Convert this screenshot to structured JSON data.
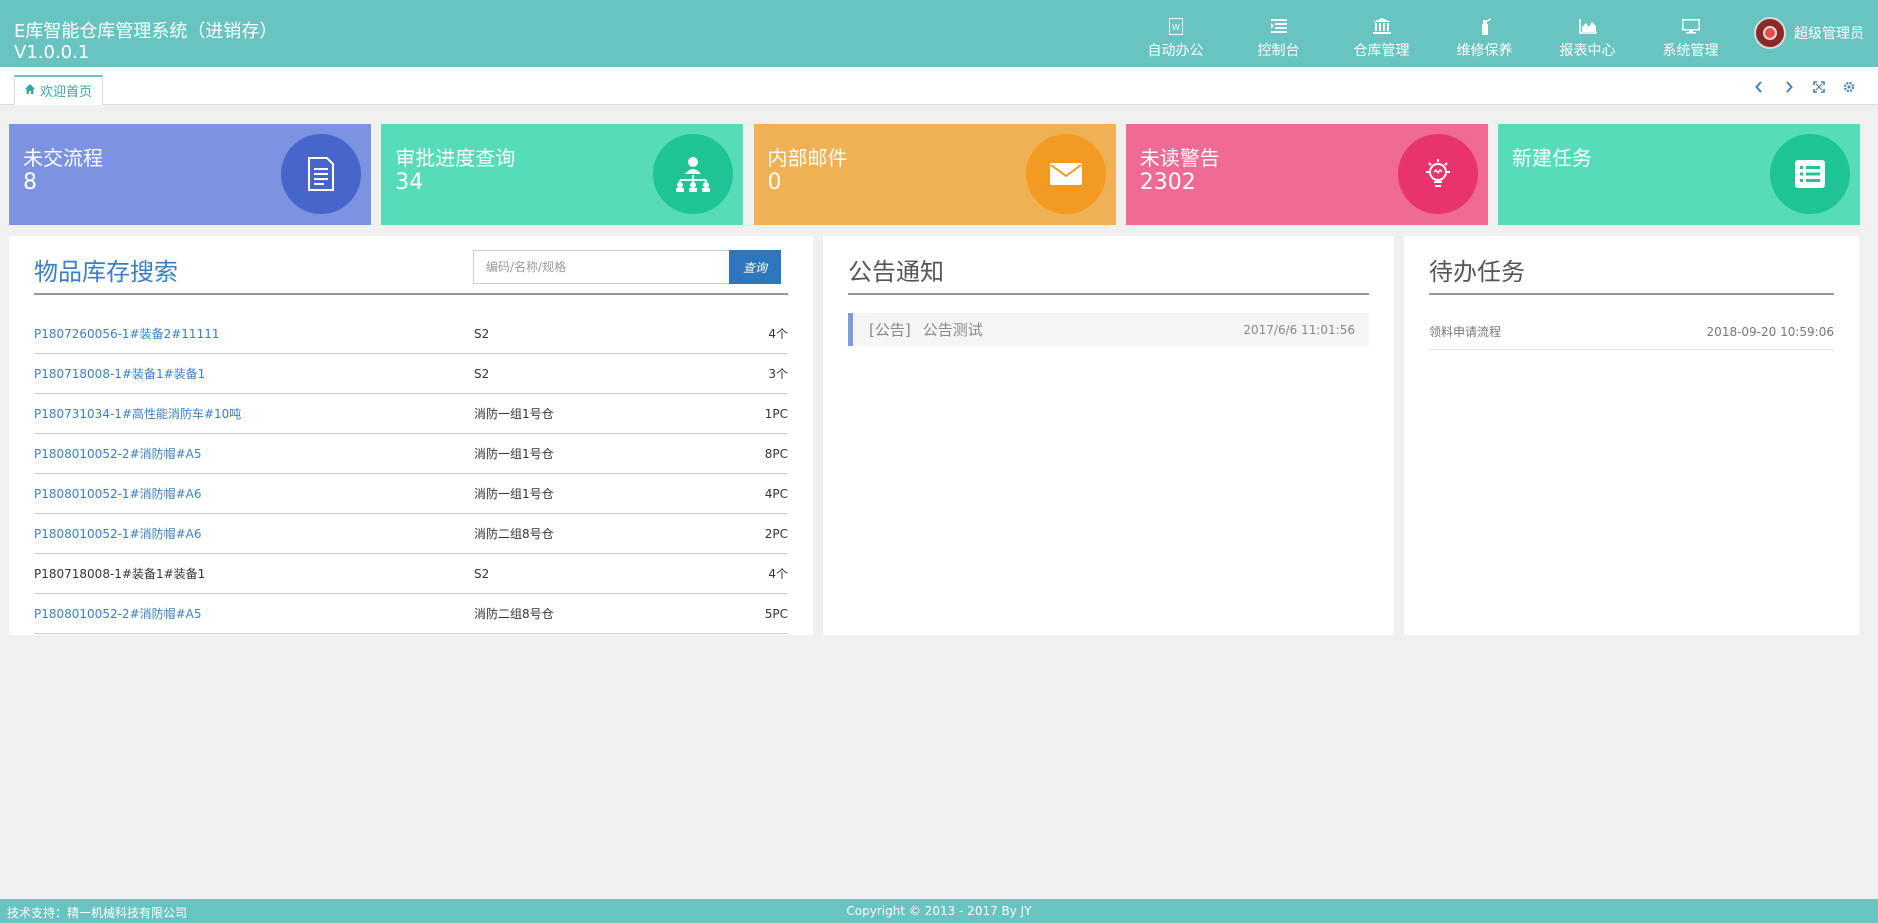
{
  "header": {
    "title": "E库智能仓库管理系统（进销存）",
    "version": "V1.0.0.1",
    "nav": [
      {
        "label": "自动办公",
        "icon": "word-doc-icon"
      },
      {
        "label": "控制台",
        "icon": "console-list-icon"
      },
      {
        "label": "仓库管理",
        "icon": "bank-building-icon"
      },
      {
        "label": "维修保养",
        "icon": "fire-extinguisher-icon"
      },
      {
        "label": "报表中心",
        "icon": "area-chart-icon"
      },
      {
        "label": "系统管理",
        "icon": "monitor-icon"
      }
    ],
    "user": {
      "name": "超级管理员"
    }
  },
  "tabs": {
    "home_label": "欢迎首页"
  },
  "cards": [
    {
      "title": "未交流程",
      "value": "8",
      "color": "#7b93e0",
      "icon_bg": "#4766cc",
      "icon": "document-icon"
    },
    {
      "title": "审批进度查询",
      "value": "34",
      "color": "#56dcb9",
      "icon_bg": "#1ec495",
      "icon": "org-chart-icon"
    },
    {
      "title": "内部邮件",
      "value": "0",
      "color": "#f0b155",
      "icon_bg": "#f29a22",
      "icon": "envelope-icon"
    },
    {
      "title": "未读警告",
      "value": "2302",
      "color": "#f06b94",
      "icon_bg": "#e8336b",
      "icon": "lightbulb-icon"
    },
    {
      "title": "新建任务",
      "value": "",
      "color": "#56dcb9",
      "icon_bg": "#1ec495",
      "icon": "task-list-icon"
    }
  ],
  "search_panel": {
    "title": "物品库存搜索",
    "placeholder": "编码/名称/规格",
    "button_label": "查询",
    "rows": [
      {
        "code": "P1807260056-1#装备2#11111",
        "location": "S2",
        "qty": "4个",
        "link": true
      },
      {
        "code": "P180718008-1#装备1#装备1",
        "location": "S2",
        "qty": "3个",
        "link": true
      },
      {
        "code": "P180731034-1#高性能消防车#10吨",
        "location": "消防一组1号仓",
        "qty": "1PC",
        "link": true
      },
      {
        "code": "P1808010052-2#消防帽#A5",
        "location": "消防一组1号仓",
        "qty": "8PC",
        "link": true
      },
      {
        "code": "P1808010052-1#消防帽#A6",
        "location": "消防一组1号仓",
        "qty": "4PC",
        "link": true
      },
      {
        "code": "P1808010052-1#消防帽#A6",
        "location": "消防二组8号仓",
        "qty": "2PC",
        "link": true
      },
      {
        "code": "P180718008-1#装备1#装备1",
        "location": "S2",
        "qty": "4个",
        "link": false
      },
      {
        "code": "P1808010052-2#消防帽#A5",
        "location": "消防二组8号仓",
        "qty": "5PC",
        "link": true
      }
    ]
  },
  "notice_panel": {
    "title": "公告通知",
    "items": [
      {
        "tag": "[公告]",
        "text": "公告测试",
        "date": "2017/6/6 11:01:56"
      }
    ]
  },
  "todo_panel": {
    "title": "待办任务",
    "items": [
      {
        "name": "领料申请流程",
        "date": "2018-09-20 10:59:06"
      }
    ]
  },
  "footer": {
    "support": "技术支持：精一机械科技有限公司",
    "copyright": "Copyright © 2013 - 2017 By JY"
  }
}
